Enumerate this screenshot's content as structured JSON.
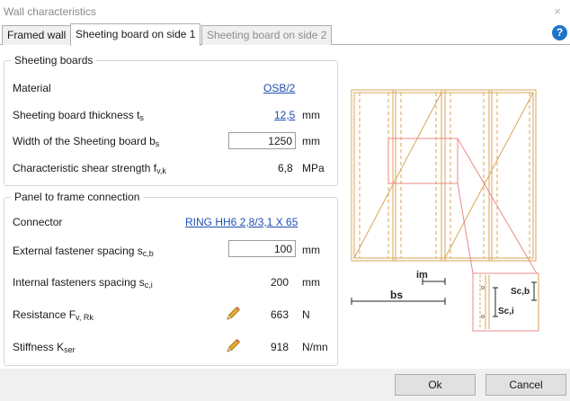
{
  "window": {
    "title": "Wall characteristics",
    "close_label": "×"
  },
  "tabs": [
    {
      "label": "Framed wall",
      "state": "normal"
    },
    {
      "label": "Sheeting board on side 1",
      "state": "active"
    },
    {
      "label": "Sheeting board on side 2",
      "state": "disabled"
    }
  ],
  "help_label": "?",
  "sheeting": {
    "legend": "Sheeting boards",
    "material_label": "Material",
    "material_value": "OSB/2",
    "thickness_label": "Sheeting board thickness t",
    "thickness_sub": "s",
    "thickness_value": "12,5",
    "thickness_unit": "mm",
    "width_label": "Width of the Sheeting board b",
    "width_sub": "s",
    "width_value": "1250",
    "width_unit": "mm",
    "shear_label": "Characteristic shear strength f",
    "shear_sub": "v,k",
    "shear_value": "6,8",
    "shear_unit": "MPa"
  },
  "panel": {
    "legend": "Panel to frame connection",
    "connector_label": "Connector",
    "connector_value": "RING HH6 2,8/3,1 X 65",
    "ext_label": "External fastener spacing s",
    "ext_sub": "c,b",
    "ext_value": "100",
    "ext_unit": "mm",
    "int_label": "Internal fasteners spacing s",
    "int_sub": "c,i",
    "int_value": "200",
    "int_unit": "mm",
    "res_label": "Resistance F",
    "res_sub": "v, Rk",
    "res_value": "663",
    "res_unit": "N",
    "stiff_label": "Stiffness K",
    "stiff_sub": "ser",
    "stiff_value": "918",
    "stiff_unit": "N/mn"
  },
  "diagram": {
    "label_im": "im",
    "label_bs": "bs",
    "label_scb": "Sc,b",
    "label_sci": "Sc,i"
  },
  "colors": {
    "frame": "#d9a55a",
    "detail": "#e88a8a",
    "link": "#1f4fb3",
    "help": "#1e73c8"
  },
  "footer": {
    "ok_label": "Ok",
    "cancel_label": "Cancel"
  }
}
